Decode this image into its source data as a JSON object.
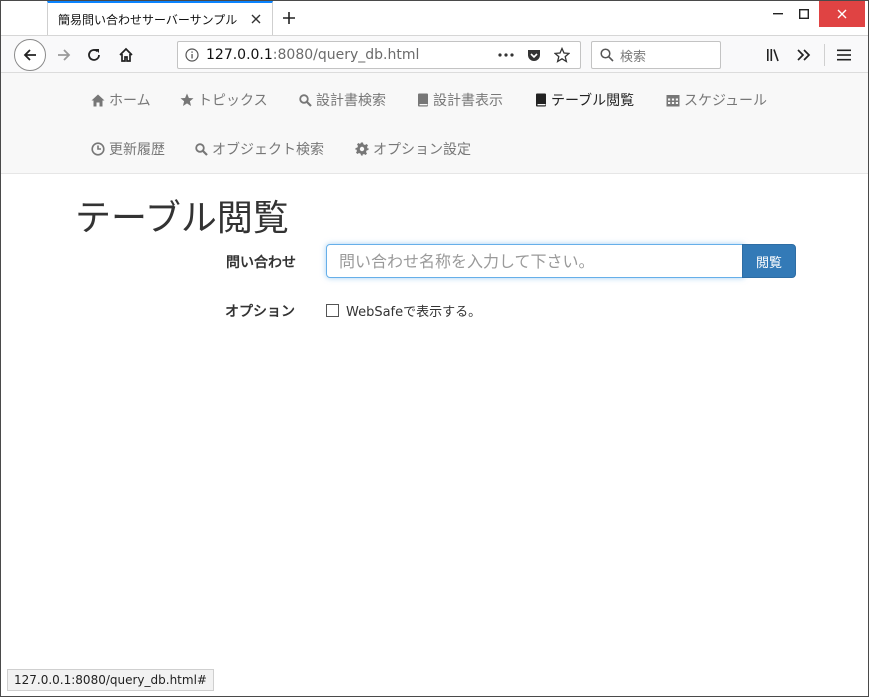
{
  "browser": {
    "tab_title": "簡易問い合わせサーバーサンプル",
    "url_host": "127.0.0.1",
    "url_rest": ":8080/query_db.html",
    "search_placeholder": "検索",
    "status_url": "127.0.0.1:8080/query_db.html#"
  },
  "nav": {
    "items": [
      {
        "label": "ホーム",
        "icon": "home-icon"
      },
      {
        "label": "トピックス",
        "icon": "star-icon"
      },
      {
        "label": "設計書検索",
        "icon": "search-icon"
      },
      {
        "label": "設計書表示",
        "icon": "book-icon"
      },
      {
        "label": "テーブル閲覧",
        "icon": "book-icon",
        "active": true
      },
      {
        "label": "スケジュール",
        "icon": "calendar-icon"
      },
      {
        "label": "更新履歴",
        "icon": "clock-icon"
      },
      {
        "label": "オブジェクト検索",
        "icon": "search-icon"
      },
      {
        "label": "オプション設定",
        "icon": "gear-icon"
      }
    ]
  },
  "page": {
    "title": "テーブル閲覧",
    "query_label": "問い合わせ",
    "query_placeholder": "問い合わせ名称を入力して下さい。",
    "query_value": "",
    "browse_button": "閲覧",
    "option_label": "オプション",
    "websafe_label": "WebSafeで表示する。",
    "websafe_checked": false
  },
  "colors": {
    "primary": "#337ab7",
    "close_red": "#e04343",
    "tab_accent": "#0a84ff",
    "input_focus": "#66afe9"
  }
}
